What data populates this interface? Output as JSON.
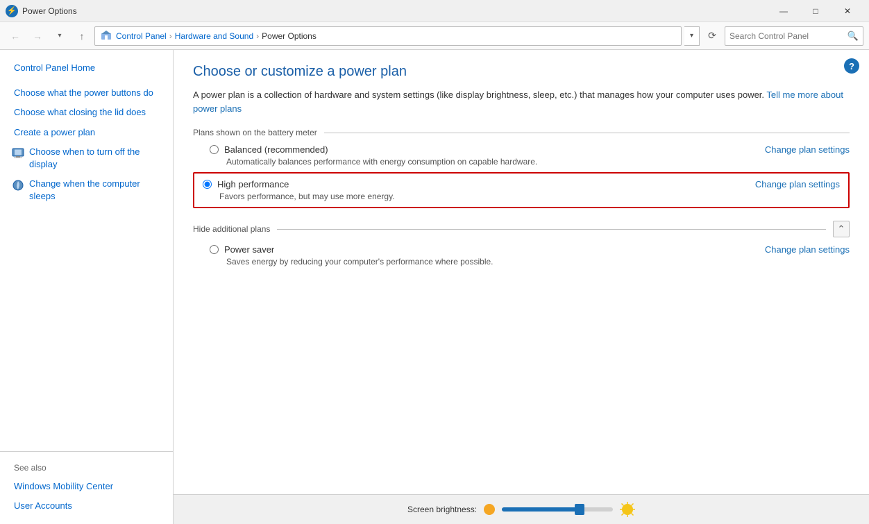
{
  "window": {
    "title": "Power Options",
    "icon_color": "#1a6fb5"
  },
  "titlebar": {
    "minimize": "—",
    "maximize": "□",
    "close": "✕"
  },
  "addressbar": {
    "back_label": "←",
    "forward_label": "→",
    "up_label": "↑",
    "breadcrumb": [
      {
        "label": "Control Panel",
        "sep": "›"
      },
      {
        "label": "Hardware and Sound",
        "sep": "›"
      },
      {
        "label": "Power Options",
        "sep": ""
      }
    ],
    "refresh_label": "⟳",
    "search_placeholder": "Search Control Panel",
    "search_icon": "🔍"
  },
  "sidebar": {
    "links": [
      {
        "id": "control-panel-home",
        "label": "Control Panel Home",
        "hasIcon": false
      },
      {
        "id": "power-buttons",
        "label": "Choose what the power buttons do",
        "hasIcon": false
      },
      {
        "id": "closing-lid",
        "label": "Choose what closing the lid does",
        "hasIcon": false
      },
      {
        "id": "create-plan",
        "label": "Create a power plan",
        "hasIcon": false
      },
      {
        "id": "turn-off-display",
        "label": "Choose when to turn off the display",
        "hasIcon": true,
        "iconColor": "#1a6fb5"
      },
      {
        "id": "computer-sleeps",
        "label": "Change when the computer sleeps",
        "hasIcon": true,
        "iconColor": "#1a6fb5"
      }
    ],
    "see_also_label": "See also",
    "see_also_links": [
      {
        "id": "windows-mobility",
        "label": "Windows Mobility Center"
      },
      {
        "id": "user-accounts",
        "label": "User Accounts"
      }
    ]
  },
  "content": {
    "title": "Choose or customize a power plan",
    "description": "A power plan is a collection of hardware and system settings (like display brightness, sleep, etc.) that manages how your computer uses power.",
    "learn_more_link": "Tell me more about power plans",
    "plans_section_label": "Plans shown on the battery meter",
    "plans": [
      {
        "id": "balanced",
        "label": "Balanced (recommended)",
        "checked": false,
        "change_link": "Change plan settings",
        "description": "Automatically balances performance with energy consumption on capable hardware.",
        "highlighted": false
      },
      {
        "id": "high-performance",
        "label": "High performance",
        "checked": true,
        "change_link": "Change plan settings",
        "description": "Favors performance, but may use more energy.",
        "highlighted": true
      }
    ],
    "additional_section_label": "Hide additional plans",
    "additional_plans": [
      {
        "id": "power-saver",
        "label": "Power saver",
        "checked": false,
        "change_link": "Change plan settings",
        "description": "Saves energy by reducing your computer's performance where possible.",
        "highlighted": false
      }
    ]
  },
  "bottom": {
    "brightness_label": "Screen brightness:",
    "slider_percent": 70
  }
}
